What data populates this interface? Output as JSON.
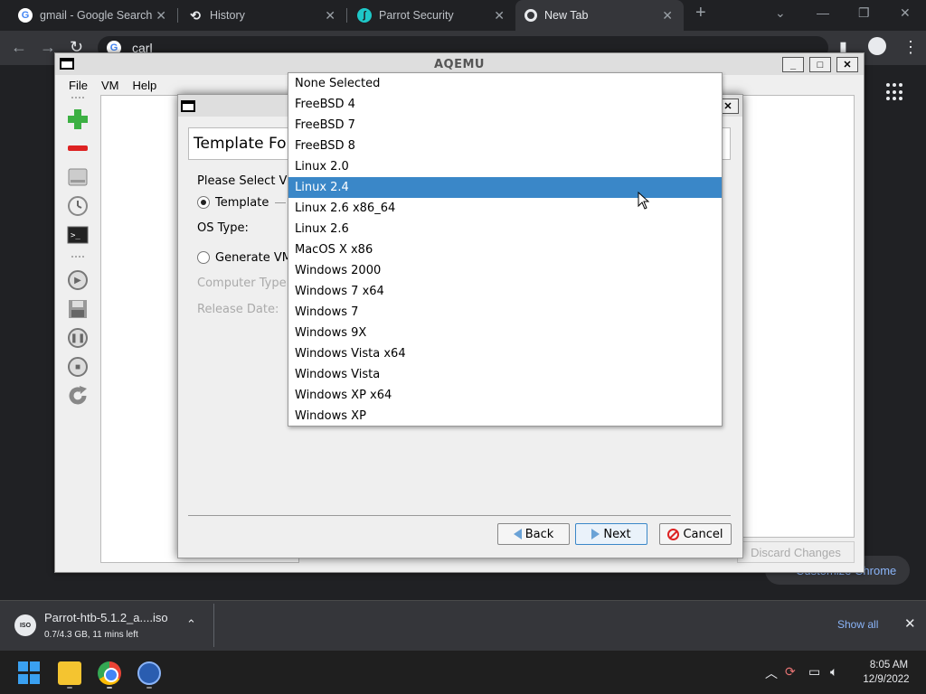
{
  "browser": {
    "tabs": [
      {
        "label": "gmail - Google Search",
        "icon": "google-icon"
      },
      {
        "label": "History",
        "icon": "history-icon"
      },
      {
        "label": "Parrot Security",
        "icon": "parrot-icon"
      },
      {
        "label": "New Tab",
        "icon": "chrome-icon"
      }
    ],
    "new_tab_symbol": "+",
    "address": "carl",
    "customize_label": "Customize Chrome"
  },
  "aqemu": {
    "title": "AQEMU",
    "menu": [
      "File",
      "VM",
      "Help"
    ],
    "discard_label": "Discard Changes"
  },
  "wizard": {
    "header": "Template For",
    "select_label": "Please Select VM",
    "template_radio": "Template",
    "os_type_label": "OS Type:",
    "generate_radio": "Generate VM",
    "computer_type_label": "Computer Type:",
    "release_date_label": "Release Date:",
    "buttons": {
      "back": "Back",
      "next": "Next",
      "cancel": "Cancel"
    }
  },
  "dropdown": {
    "selected_index": 5,
    "options": [
      "None Selected",
      "FreeBSD 4",
      "FreeBSD 7",
      "FreeBSD 8",
      "Linux 2.0",
      "Linux 2.4",
      "Linux 2.6 x86_64",
      "Linux 2.6",
      "MacOS X x86",
      "Windows 2000",
      "Windows 7 x64",
      "Windows 7",
      "Windows 9X",
      "Windows Vista x64",
      "Windows Vista",
      "Windows XP x64",
      "Windows XP"
    ]
  },
  "downloads": {
    "file_name": "Parrot-htb-5.1.2_a....iso",
    "progress": "0.7/4.3 GB, 11 mins left",
    "icon_text": "ISO",
    "show_all": "Show all"
  },
  "taskbar": {
    "time": "8:05 AM",
    "date": "12/9/2022"
  },
  "colors": {
    "selection": "#3a87c8",
    "chrome_dark": "#202124",
    "link_blue": "#8ab4f8"
  }
}
